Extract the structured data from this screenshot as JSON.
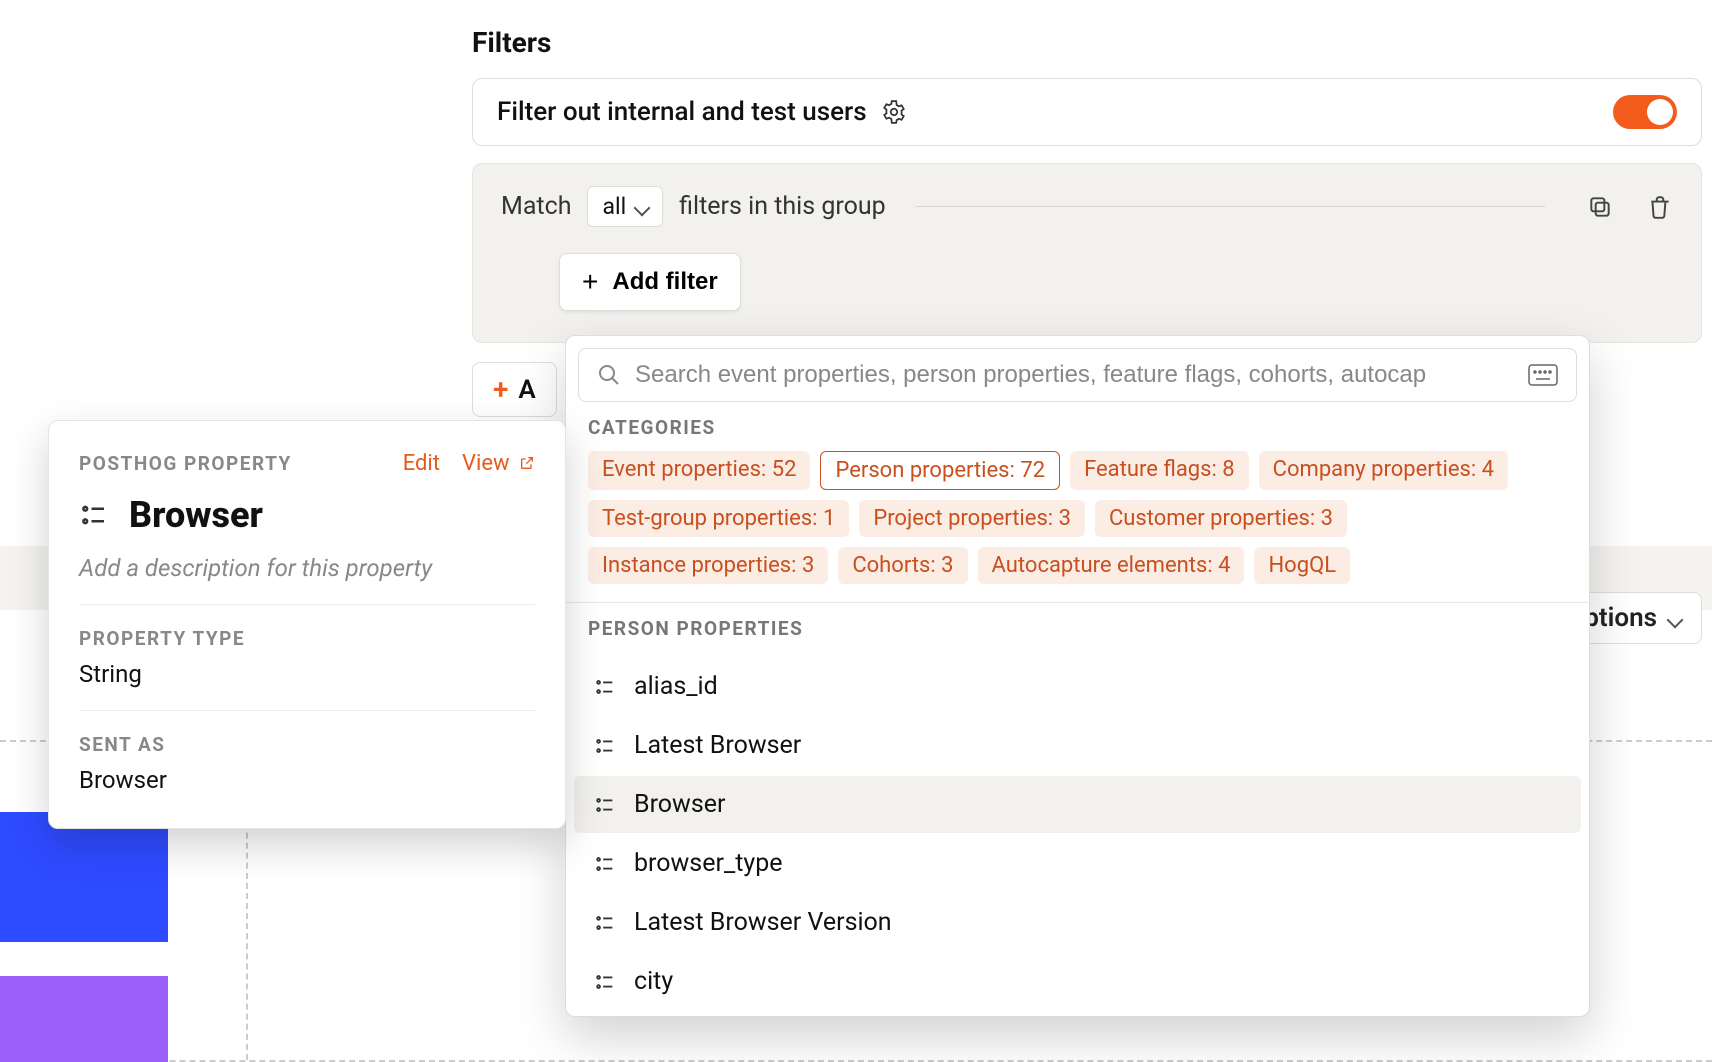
{
  "filters": {
    "heading": "Filters",
    "internal_users_label": "Filter out internal and test users",
    "internal_users_toggle": true,
    "group": {
      "match": "Match",
      "match_mode": "all",
      "group_text": "filters in this group",
      "add_filter_label": "Add filter"
    },
    "add_group_partial": "A"
  },
  "popover": {
    "search_placeholder": "Search event properties, person properties, feature flags, cohorts, autocap",
    "categories_heading": "CATEGORIES",
    "categories": [
      {
        "label": "Event properties: 52",
        "active": false
      },
      {
        "label": "Person properties: 72",
        "active": true
      },
      {
        "label": "Feature flags: 8",
        "active": false
      },
      {
        "label": "Company properties: 4",
        "active": false
      },
      {
        "label": "Test-group properties: 1",
        "active": false
      },
      {
        "label": "Project properties: 3",
        "active": false
      },
      {
        "label": "Customer properties: 3",
        "active": false
      },
      {
        "label": "Instance properties: 3",
        "active": false
      },
      {
        "label": "Cohorts: 3",
        "active": false
      },
      {
        "label": "Autocapture elements: 4",
        "active": false
      },
      {
        "label": "HogQL",
        "active": false
      }
    ],
    "list_heading": "PERSON PROPERTIES",
    "items": [
      {
        "label": "alias_id",
        "hover": false
      },
      {
        "label": "Latest Browser",
        "hover": false
      },
      {
        "label": "Browser",
        "hover": true
      },
      {
        "label": "browser_type",
        "hover": false
      },
      {
        "label": "Latest Browser Version",
        "hover": false
      },
      {
        "label": "city",
        "hover": false
      }
    ]
  },
  "tooltip": {
    "kicker": "POSTHOG PROPERTY",
    "edit": "Edit",
    "view": "View",
    "title": "Browser",
    "description_placeholder": "Add a description for this property",
    "type_label": "PROPERTY TYPE",
    "type_value": "String",
    "sent_as_label": "SENT AS",
    "sent_as_value": "Browser"
  },
  "options_button": "Options"
}
